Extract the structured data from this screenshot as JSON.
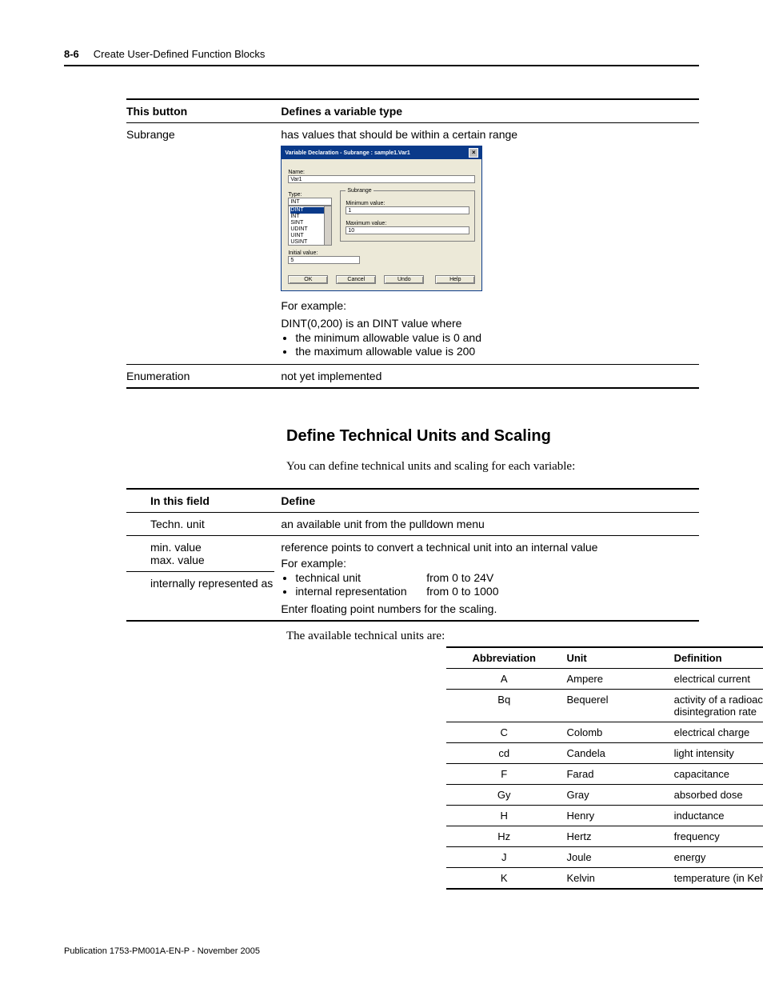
{
  "header": {
    "page_number": "8-6",
    "chapter_title": "Create User-Defined Function Blocks"
  },
  "table_variable_type": {
    "headers": {
      "c1": "This button",
      "c2": "Defines a variable type"
    },
    "rows": [
      {
        "button": "Subrange",
        "definition": "has values that should be within a certain range",
        "example_lead": "For example:",
        "example_text": "DINT(0,200) is an DINT value where",
        "example_bullets": [
          "the minimum allowable value is 0 and",
          "the maximum allowable value is 200"
        ]
      },
      {
        "button": "Enumeration",
        "definition": "not yet implemented"
      }
    ]
  },
  "dialog": {
    "title": "Variable Declaration - Subrange : sample1.Var1",
    "name_label": "Name:",
    "name_value": "Var1",
    "type_label": "Type:",
    "type_selected": "INT",
    "type_list": [
      "DINT",
      "INT",
      "SINT",
      "UDINT",
      "UINT",
      "USINT"
    ],
    "subrange_legend": "Subrange",
    "min_label": "Minimum value:",
    "min_value": "1",
    "max_label": "Maximum value:",
    "max_value": "10",
    "init_label": "Initial value:",
    "init_value": "5",
    "buttons": {
      "ok": "OK",
      "cancel": "Cancel",
      "undo": "Undo",
      "help": "Help"
    }
  },
  "section_heading": "Define Technical Units and Scaling",
  "section_intro": "You can define technical units and scaling for each variable:",
  "table_fields": {
    "headers": {
      "c1": "In this field",
      "c2": "Define"
    },
    "row1": {
      "field": "Techn. unit",
      "value": "an available unit from the pulldown menu"
    },
    "row2": {
      "field_a": "min. value",
      "field_b": "max. value",
      "field_c": "internally represented as",
      "value_top": "reference points to convert a technical unit into an internal value",
      "value_example_lead": "For example:",
      "bullet1_l": "technical unit",
      "bullet1_r": "from 0 to 24V",
      "bullet2_l": "internal representation",
      "bullet2_r": "from 0 to 1000",
      "value_bottom": "Enter floating point numbers for the scaling."
    }
  },
  "units_intro": "The available technical units are:",
  "table_units": {
    "headers": {
      "c1": "Abbreviation",
      "c2": "Unit",
      "c3": "Definition"
    },
    "rows": [
      {
        "abbr": "A",
        "unit": "Ampere",
        "def": "electrical current"
      },
      {
        "abbr": "Bq",
        "unit": "Bequerel",
        "def": "activity of a radioactive source, disintegration rate"
      },
      {
        "abbr": "C",
        "unit": "Colomb",
        "def": "electrical charge"
      },
      {
        "abbr": "cd",
        "unit": "Candela",
        "def": "light intensity"
      },
      {
        "abbr": "F",
        "unit": "Farad",
        "def": "capacitance"
      },
      {
        "abbr": "Gy",
        "unit": "Gray",
        "def": "absorbed dose"
      },
      {
        "abbr": "H",
        "unit": "Henry",
        "def": "inductance"
      },
      {
        "abbr": "Hz",
        "unit": "Hertz",
        "def": "frequency"
      },
      {
        "abbr": "J",
        "unit": "Joule",
        "def": "energy"
      },
      {
        "abbr": "K",
        "unit": "Kelvin",
        "def": "temperature (in Kelvin)"
      }
    ]
  },
  "footer": "Publication 1753-PM001A-EN-P - November 2005"
}
